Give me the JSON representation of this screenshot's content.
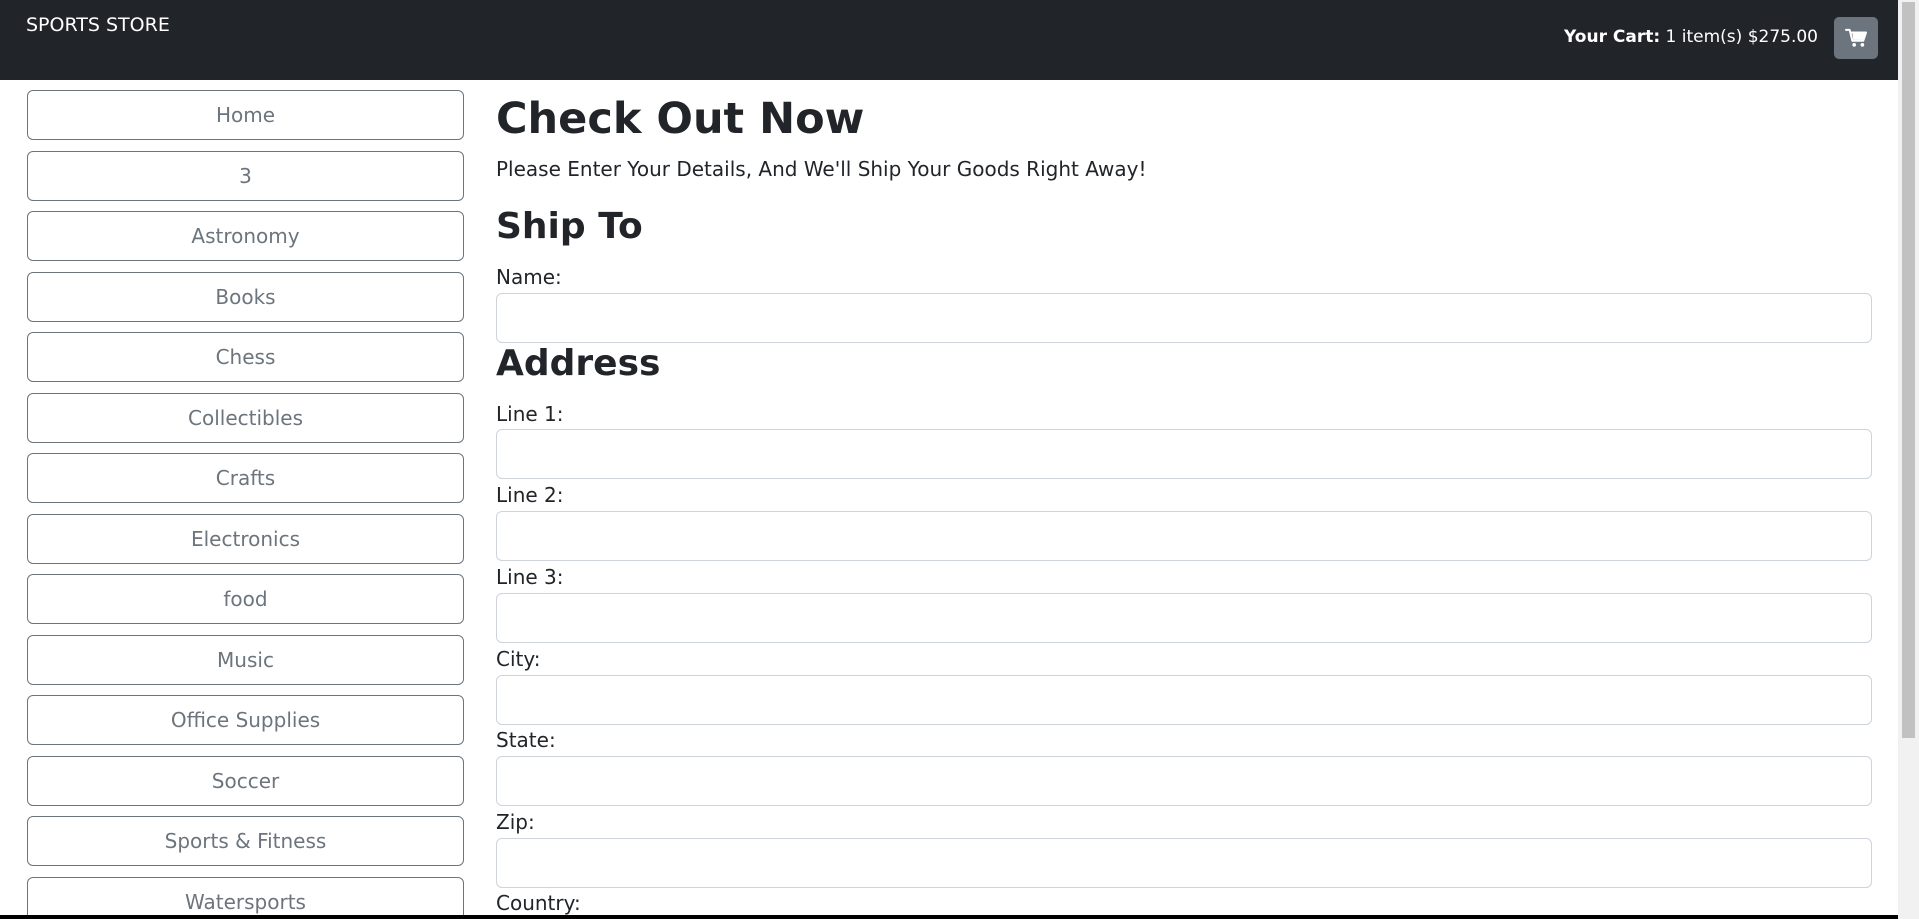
{
  "navbar": {
    "brand": "SPORTS STORE",
    "cart": {
      "label": "Your Cart:",
      "summary": "1 item(s) $275.00",
      "icon": "shopping-cart-icon"
    }
  },
  "sidebar": {
    "items": [
      {
        "label": "Home"
      },
      {
        "label": "3"
      },
      {
        "label": "Astronomy"
      },
      {
        "label": "Books"
      },
      {
        "label": "Chess"
      },
      {
        "label": "Collectibles"
      },
      {
        "label": "Crafts"
      },
      {
        "label": "Electronics"
      },
      {
        "label": "food"
      },
      {
        "label": "Music"
      },
      {
        "label": "Office Supplies"
      },
      {
        "label": "Soccer"
      },
      {
        "label": "Sports & Fitness"
      },
      {
        "label": "Watersports"
      }
    ]
  },
  "checkout": {
    "title": "Check Out Now",
    "intro": "Please Enter Your Details, And We'll Ship Your Goods Right Away!",
    "ship_to_heading": "Ship To",
    "name_label": "Name:",
    "name_value": "",
    "address_heading": "Address",
    "fields": [
      {
        "label": "Line 1:",
        "value": ""
      },
      {
        "label": "Line 2:",
        "value": ""
      },
      {
        "label": "Line 3:",
        "value": ""
      },
      {
        "label": "City:",
        "value": ""
      },
      {
        "label": "State:",
        "value": ""
      },
      {
        "label": "Zip:",
        "value": ""
      }
    ],
    "country_label": "Country:"
  },
  "colors": {
    "navbar_bg": "#212529",
    "cart_button_bg": "#6c757d",
    "category_border": "#6c757d",
    "input_border": "#ced4da"
  }
}
